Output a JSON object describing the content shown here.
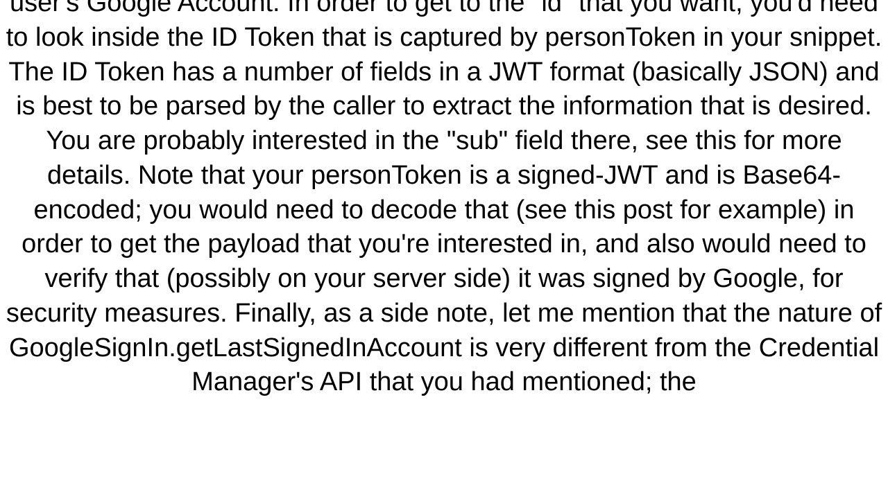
{
  "document": {
    "paragraph": "user's Google Account.  In order to get to the \"id\" that you want, you'd need to look inside the ID Token that is captured by personToken in your snippet. The ID Token has a number of fields in a JWT format (basically JSON) and is best to be parsed by the caller to extract the information that is desired. You are probably interested in the \"sub\" field there, see this for more details. Note that your personToken is a signed-JWT and is Base64-encoded; you would need to decode that (see this post for example) in order to get the payload that you're interested in, and also would need to verify that (possibly on your server side) it was signed by Google, for security measures. Finally, as a side note, let me mention that the nature of GoogleSignIn.getLastSignedInAccount is very different from the Credential Manager's API that you had mentioned; the"
  }
}
